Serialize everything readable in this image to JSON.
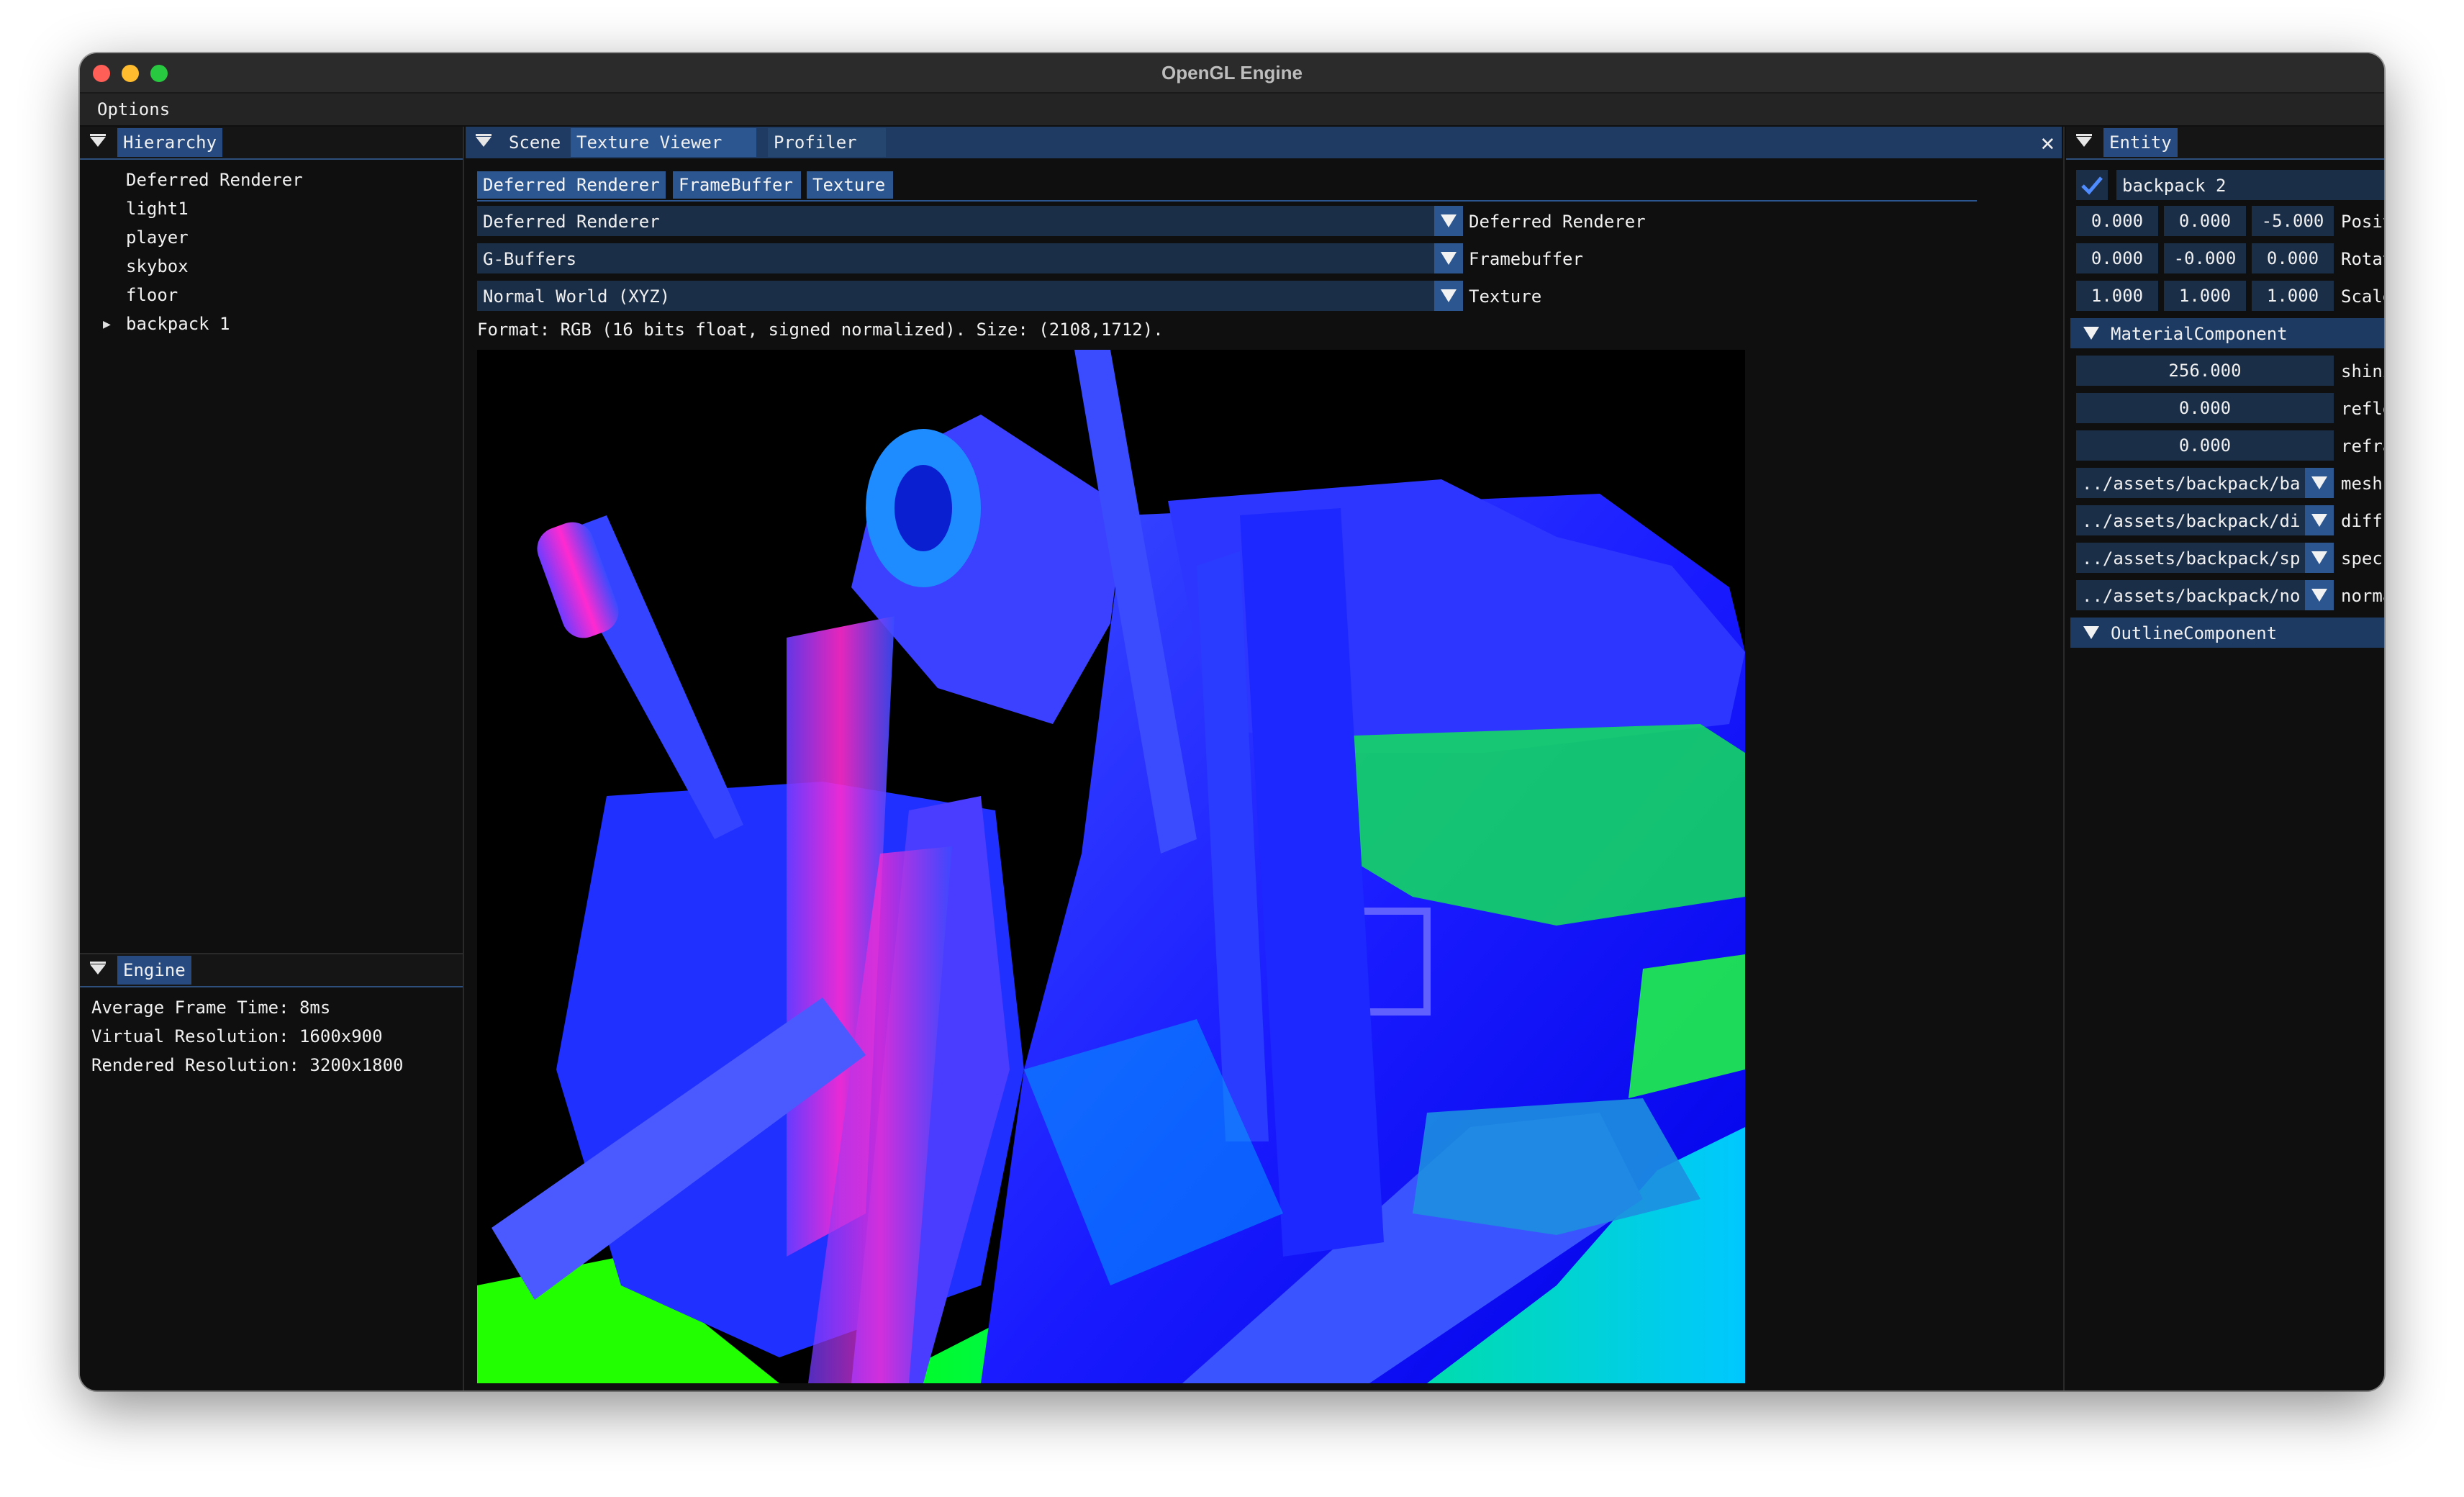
{
  "window": {
    "title": "OpenGL Engine"
  },
  "menubar": {
    "options": "Options"
  },
  "hierarchy": {
    "tab": "Hierarchy",
    "items": [
      "Deferred Renderer",
      "light1",
      "player",
      "skybox",
      "floor",
      "backpack 1"
    ]
  },
  "engine": {
    "tab": "Engine",
    "lines": [
      "Average Frame Time: 8ms",
      "Virtual Resolution: 1600x900",
      "Rendered Resolution: 3200x1800"
    ]
  },
  "center": {
    "tabs": [
      "Scene",
      "Texture Viewer",
      "Profiler"
    ],
    "subtabs": [
      "Deferred Renderer",
      "FrameBuffer",
      "Texture"
    ],
    "combos": [
      {
        "value": "Deferred Renderer",
        "label": "Deferred Renderer"
      },
      {
        "value": "G-Buffers",
        "label": "Framebuffer"
      },
      {
        "value": "Normal World (XYZ)",
        "label": "Texture"
      }
    ],
    "format_text": "Format: RGB (16 bits float, signed normalized). Size: (2108,1712).",
    "close_symbol": "✕"
  },
  "entity": {
    "tab": "Entity",
    "name": "backpack 2",
    "enabled": true,
    "position": {
      "values": [
        "0.000",
        "0.000",
        "-5.000"
      ],
      "label": "Position"
    },
    "rotation": {
      "values": [
        "0.000",
        "-0.000",
        "0.000"
      ],
      "label": "Rotation"
    },
    "scale": {
      "values": [
        "1.000",
        "1.000",
        "1.000"
      ],
      "label": "Scale"
    },
    "material": {
      "header": "MaterialComponent",
      "shininess": {
        "value": "256.000",
        "label": "shininess"
      },
      "reflection": {
        "value": "0.000",
        "label": "reflection"
      },
      "refraction": {
        "value": "0.000",
        "label": "refraction"
      },
      "mesh": {
        "value": "../assets/backpack/ba",
        "label": "mesh"
      },
      "diffuse": {
        "value": "../assets/backpack/di",
        "label": "diffuse"
      },
      "specular": {
        "value": "../assets/backpack/sp",
        "label": "specular"
      },
      "normal": {
        "value": "../assets/backpack/no",
        "label": "normal"
      }
    },
    "outline": {
      "header": "OutlineComponent"
    }
  },
  "colors": {
    "panel_bg": "#0f0f0f",
    "tab_active": "#274b80",
    "frame_bg": "#1b2e48",
    "accent_blue": "#0000ff",
    "accent_green": "#33ff00"
  }
}
